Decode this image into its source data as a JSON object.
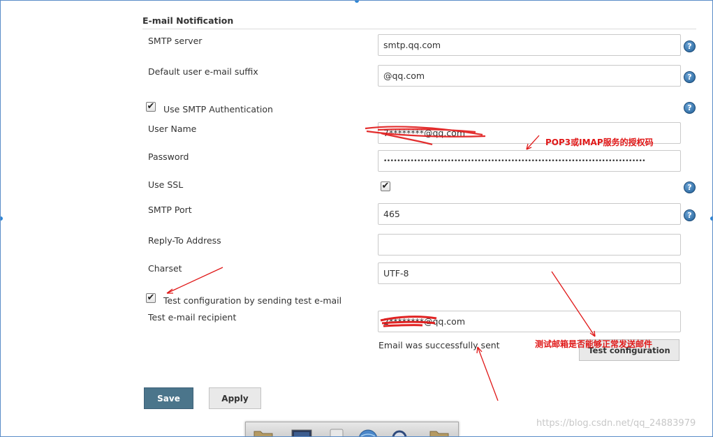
{
  "section": {
    "title": "E-mail Notification"
  },
  "fields": {
    "smtp_server": {
      "label": "SMTP server",
      "value": "smtp.qq.com"
    },
    "default_suffix": {
      "label": "Default user e-mail suffix",
      "value": "@qq.com"
    },
    "use_smtp_auth": {
      "label": "Use SMTP Authentication",
      "checked": true
    },
    "user_name": {
      "label": "User Name",
      "value": "7********@qq.com"
    },
    "password": {
      "label": "Password",
      "value": "••••••••••••••••••••••••••••••••••••••••••••••••••••••••••••••••••••••••••••••"
    },
    "use_ssl": {
      "label": "Use SSL",
      "checked": true
    },
    "smtp_port": {
      "label": "SMTP Port",
      "value": "465"
    },
    "reply_to": {
      "label": "Reply-To Address",
      "value": ""
    },
    "charset": {
      "label": "Charset",
      "value": "UTF-8"
    },
    "test_config": {
      "label": "Test configuration by sending test e-mail",
      "checked": true
    },
    "test_recipient": {
      "label": "Test e-mail recipient",
      "value": "2********@qq.com"
    }
  },
  "status": {
    "message": "Email was successfully sent"
  },
  "buttons": {
    "test_configuration": "Test configuration",
    "save": "Save",
    "apply": "Apply"
  },
  "help_icon_glyph": "?",
  "check_glyph": "✔",
  "annotations": {
    "auth_code": "POP3或IMAP服务的授权码",
    "test_mail": "测试邮箱是否能够正常发送邮件"
  },
  "watermark": "https://blog.csdn.net/qq_24883979",
  "colors": {
    "save_button": "#4b758b",
    "annotation_red": "#e01818",
    "help_icon": "#1f5e95"
  }
}
